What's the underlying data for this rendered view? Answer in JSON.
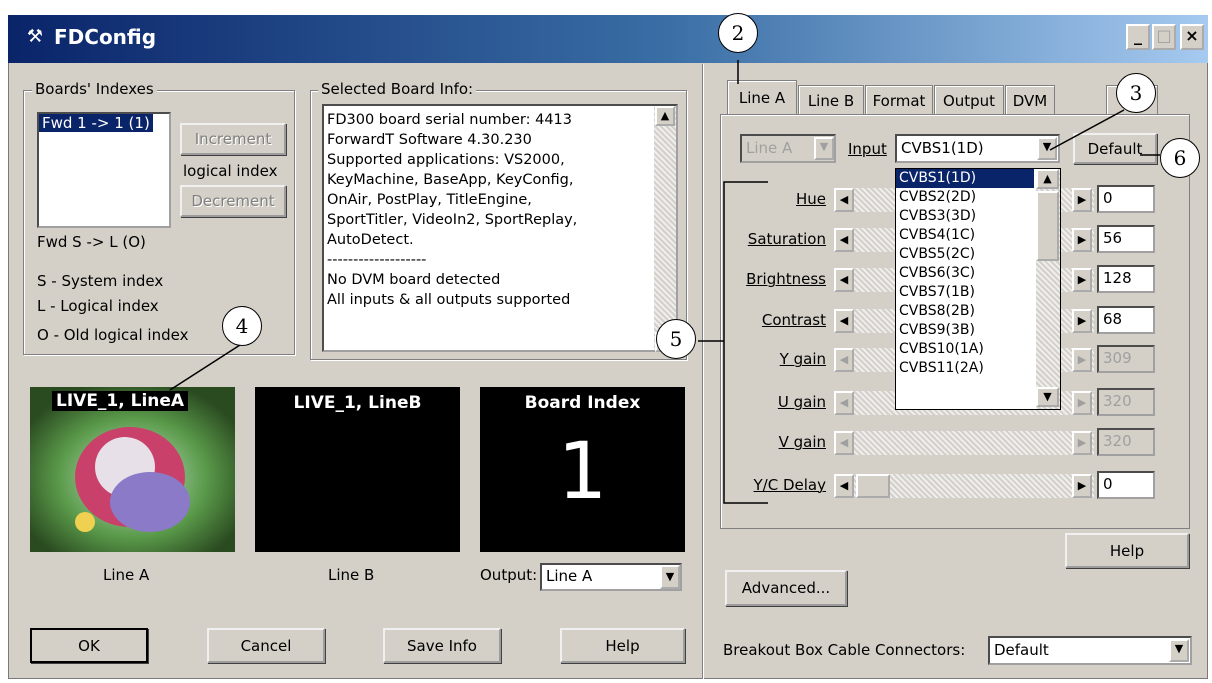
{
  "window": {
    "title": "FDConfig"
  },
  "left": {
    "boards_title": "Boards' Indexes",
    "boards_list": [
      "Fwd 1 -> 1 (1)"
    ],
    "increment": "Increment",
    "logical_index": "logical index",
    "decrement": "Decrement",
    "fwd_s_l": "Fwd S -> L (O)",
    "legend": [
      "S - System index",
      "L - Logical index",
      "O - Old logical index"
    ],
    "info_title": "Selected Board Info:",
    "info_lines": [
      "FD300 board serial number: 4413",
      "ForwardT Software 4.30.230",
      "Supported applications: VS2000,",
      "KeyMachine, BaseApp, KeyConfig,",
      "OnAir, PostPlay, TitleEngine,",
      "SportTitler, VideoIn2, SportReplay,",
      "AutoDetect.",
      "-------------------",
      "No DVM board detected",
      "All inputs & all outputs supported"
    ],
    "preview_a_title": "LIVE_1, LineA",
    "preview_b_title": "LIVE_1, LineB",
    "preview_c_title": "Board Index",
    "board_index_value": "1",
    "line_a_label": "Line A",
    "line_b_label": "Line B",
    "output_label": "Output:",
    "output_value": "Line A",
    "ok": "OK",
    "cancel": "Cancel",
    "save_info": "Save Info",
    "help": "Help"
  },
  "right": {
    "tabs": [
      "Line A",
      "Line B",
      "Format",
      "Output",
      "DVM",
      "nd"
    ],
    "line_select": "Line A",
    "input_label": "Input",
    "input_value": "CVBS1(1D)",
    "default_btn": "Default",
    "dropdown_items": [
      "CVBS1(1D)",
      "CVBS2(2D)",
      "CVBS3(3D)",
      "CVBS4(1C)",
      "CVBS5(2C)",
      "CVBS6(3C)",
      "CVBS7(1B)",
      "CVBS8(2B)",
      "CVBS9(3B)",
      "CVBS10(1A)",
      "CVBS11(2A)"
    ],
    "sliders": [
      {
        "label": "Hue",
        "value": "0",
        "enabled": true
      },
      {
        "label": "Saturation",
        "value": "56",
        "enabled": true
      },
      {
        "label": "Brightness",
        "value": "128",
        "enabled": true
      },
      {
        "label": "Contrast",
        "value": "68",
        "enabled": true
      },
      {
        "label": "Y gain",
        "value": "309",
        "enabled": false
      },
      {
        "label": "U gain",
        "value": "320",
        "enabled": false
      },
      {
        "label": "V gain",
        "value": "320",
        "enabled": false
      },
      {
        "label": "Y/C Delay",
        "value": "0",
        "enabled": true
      }
    ],
    "help": "Help",
    "advanced": "Advanced...",
    "breakout_label": "Breakout Box Cable Connectors:",
    "breakout_value": "Default"
  },
  "callouts": [
    "2",
    "3",
    "4",
    "5",
    "6"
  ],
  "colors": {
    "title_bar": "#0a246a",
    "face": "#d4d0c8",
    "highlight": "#0a246a"
  },
  "icons": [
    "app-tools-icon",
    "minimize-icon",
    "maximize-icon",
    "close-icon",
    "dropdown-arrow-icon",
    "scroll-up-icon",
    "scroll-down-icon",
    "arrow-left-icon",
    "arrow-right-icon"
  ]
}
